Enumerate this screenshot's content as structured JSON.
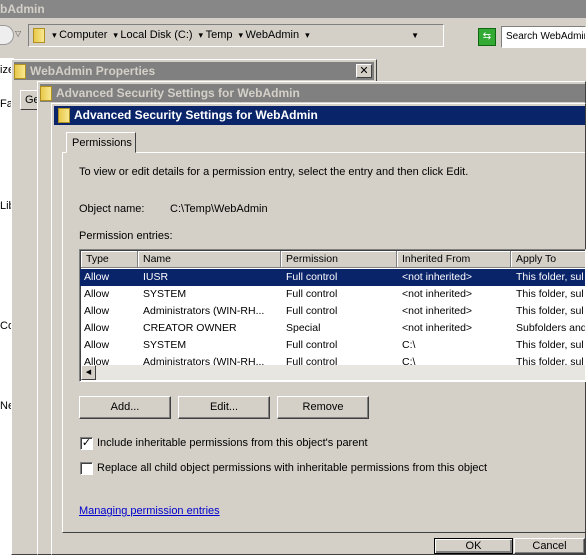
{
  "explorer": {
    "title": "bAdmin",
    "breadcrumb": [
      "Computer",
      "Local Disk (C:)",
      "Temp",
      "WebAdmin"
    ],
    "search_placeholder": "Search WebAdmin",
    "left_fragments": [
      "ize",
      "Fa",
      "Lib",
      "Co",
      "Ne"
    ]
  },
  "properties": {
    "title": "WebAdmin Properties",
    "tab": "Ge"
  },
  "adv_back": {
    "title": "Advanced Security Settings for WebAdmin"
  },
  "adv": {
    "title": "Advanced Security Settings for WebAdmin",
    "tab": "Permissions",
    "instructions": "To view or edit details for a permission entry, select the entry and then click Edit.",
    "object_name_label": "Object name:",
    "object_name": "C:\\Temp\\WebAdmin",
    "entries_label": "Permission entries:",
    "columns": [
      "Type",
      "Name",
      "Permission",
      "Inherited From",
      "Apply To"
    ],
    "rows": [
      [
        "Allow",
        "IUSR",
        "Full control",
        "<not inherited>",
        "This folder, sul"
      ],
      [
        "Allow",
        "SYSTEM",
        "Full control",
        "<not inherited>",
        "This folder, sul"
      ],
      [
        "Allow",
        "Administrators (WIN-RH...",
        "Full control",
        "<not inherited>",
        "This folder, sul"
      ],
      [
        "Allow",
        "CREATOR OWNER",
        "Special",
        "<not inherited>",
        "Subfolders and"
      ],
      [
        "Allow",
        "SYSTEM",
        "Full control",
        "C:\\",
        "This folder, sul"
      ],
      [
        "Allow",
        "Administrators (WIN-RH...",
        "Full control",
        "C:\\",
        "This folder, sul"
      ]
    ],
    "selected_row": 0,
    "add": "Add...",
    "edit": "Edit...",
    "remove": "Remove",
    "include_inheritable": {
      "label": "Include inheritable permissions from this object's parent",
      "checked": true
    },
    "replace_child": {
      "label": "Replace all child object permissions with inheritable permissions from this object",
      "checked": false
    },
    "help_link": "Managing permission entries",
    "ok": "OK",
    "cancel": "Cancel"
  },
  "colors": {
    "active_title": "#0a246a",
    "inactive_title": "#808080",
    "face": "#d4d0c8",
    "link": "#0000cc"
  }
}
